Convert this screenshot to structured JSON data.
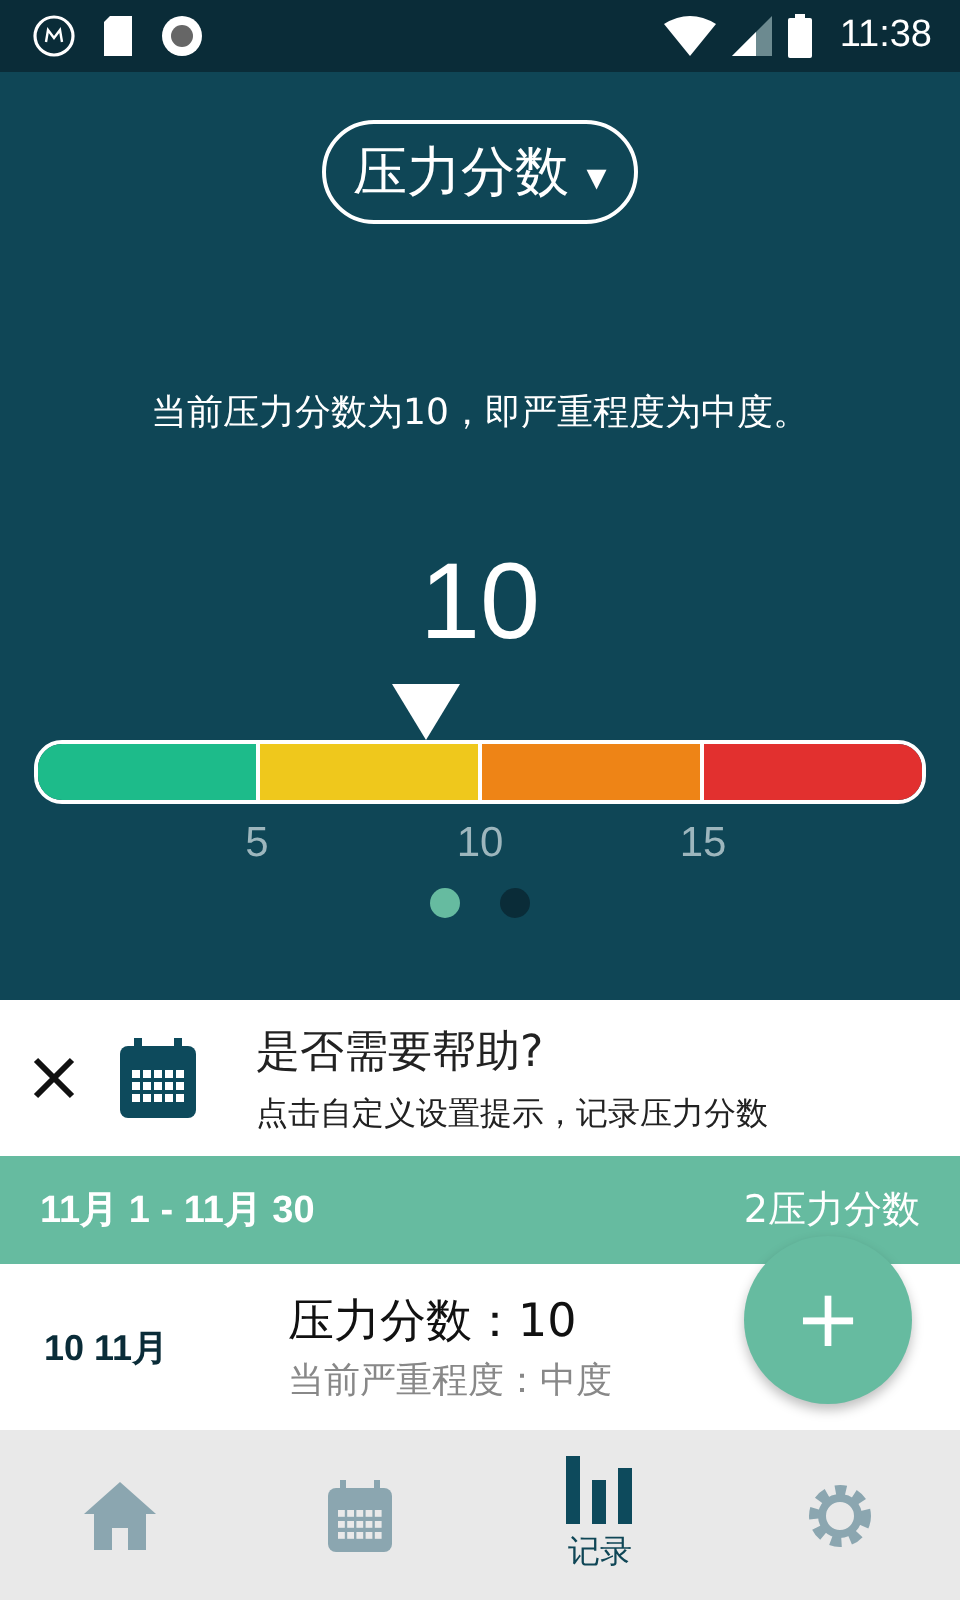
{
  "status_bar": {
    "time": "11:38"
  },
  "header": {
    "dropdown": "压力分数",
    "caret": "▾",
    "sentence": "当前压力分数为10，即严重程度为中度。",
    "score": "10",
    "level": 0.44,
    "segments": [
      {
        "color": "#1dbb8a"
      },
      {
        "color": "#efc81c"
      },
      {
        "color": "#ee8416"
      },
      {
        "color": "#e2302f"
      }
    ],
    "ticks": [
      "5",
      "10",
      "15"
    ],
    "pages": [
      {
        "selected": true
      },
      {
        "selected": false
      }
    ]
  },
  "help_card": {
    "title": "是否需要帮助?",
    "text": "点击自定义设置提示，记录压力分数"
  },
  "range_bar": {
    "range": "11月 1 - 11月 30",
    "count": "2压力分数"
  },
  "entries": [
    {
      "date": "10 11月",
      "title": "压力分数：10",
      "subtitle": "当前严重程度：中度"
    }
  ],
  "fab": {
    "label": "+"
  },
  "nav": [
    {
      "kind": "home",
      "selected": false
    },
    {
      "kind": "calendar",
      "selected": false
    },
    {
      "kind": "chart",
      "label": "记录",
      "selected": true
    },
    {
      "kind": "settings",
      "selected": false
    }
  ]
}
